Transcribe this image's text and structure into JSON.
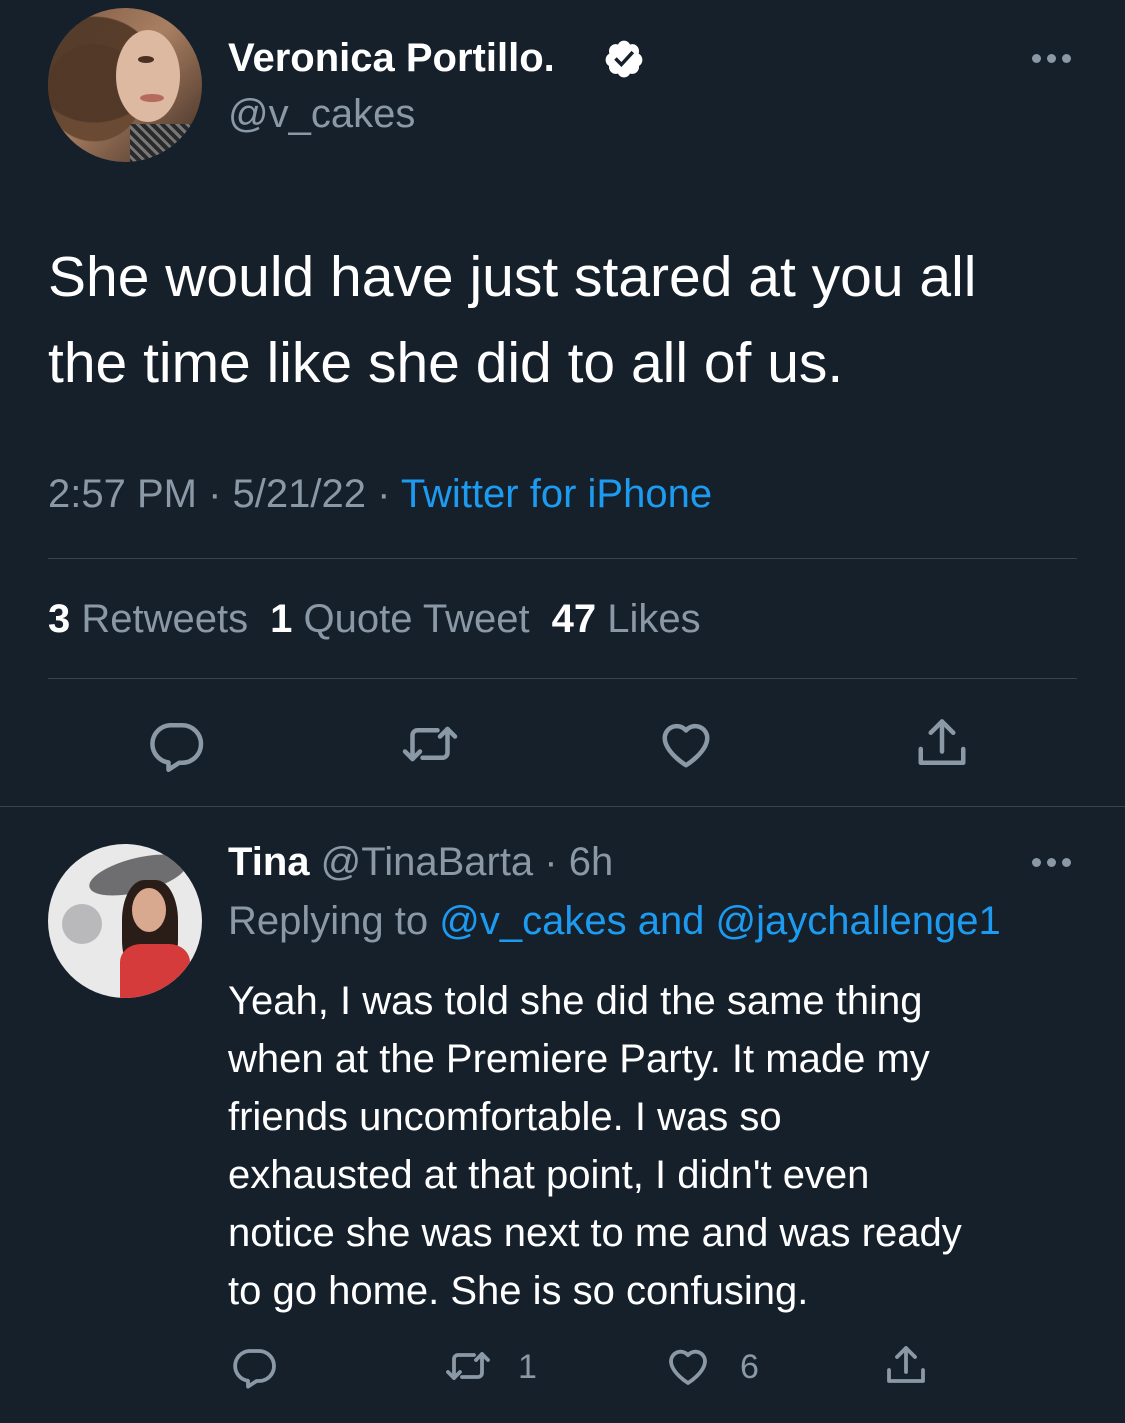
{
  "main_tweet": {
    "display_name": "Veronica Portillo.",
    "handle": "@v_cakes",
    "text": "She would have just stared at you all\nthe time like she did to all of us.",
    "time": "2:57 PM",
    "date": "5/21/22",
    "source": "Twitter for iPhone",
    "separator": " · ",
    "stats": {
      "retweets_count": "3",
      "retweets_label": "Retweets",
      "quotes_count": "1",
      "quotes_label": "Quote Tweet",
      "likes_count": "47",
      "likes_label": "Likes"
    },
    "actions": [
      "reply-icon",
      "retweet-icon",
      "like-icon",
      "share-icon"
    ]
  },
  "reply": {
    "display_name": "Tina",
    "handle": "@TinaBarta",
    "age": "6h",
    "separator": " · ",
    "replying_prefix": "Replying to ",
    "replying_user1": "@v_cakes",
    "replying_and": " and ",
    "replying_user2": "@jaychallenge1",
    "text": "Yeah, I was told she did the same thing\nwhen at the Premiere Party. It made my\nfriends uncomfortable.  I was so\nexhausted at that point, I didn't even\nnotice she was next to me and was ready\nto go home. She is so confusing.",
    "retweet_count": "1",
    "like_count": "6"
  },
  "colors": {
    "background": "#15202b",
    "link": "#1d9bf0",
    "muted": "#8b98a5",
    "divider": "#38444d"
  }
}
